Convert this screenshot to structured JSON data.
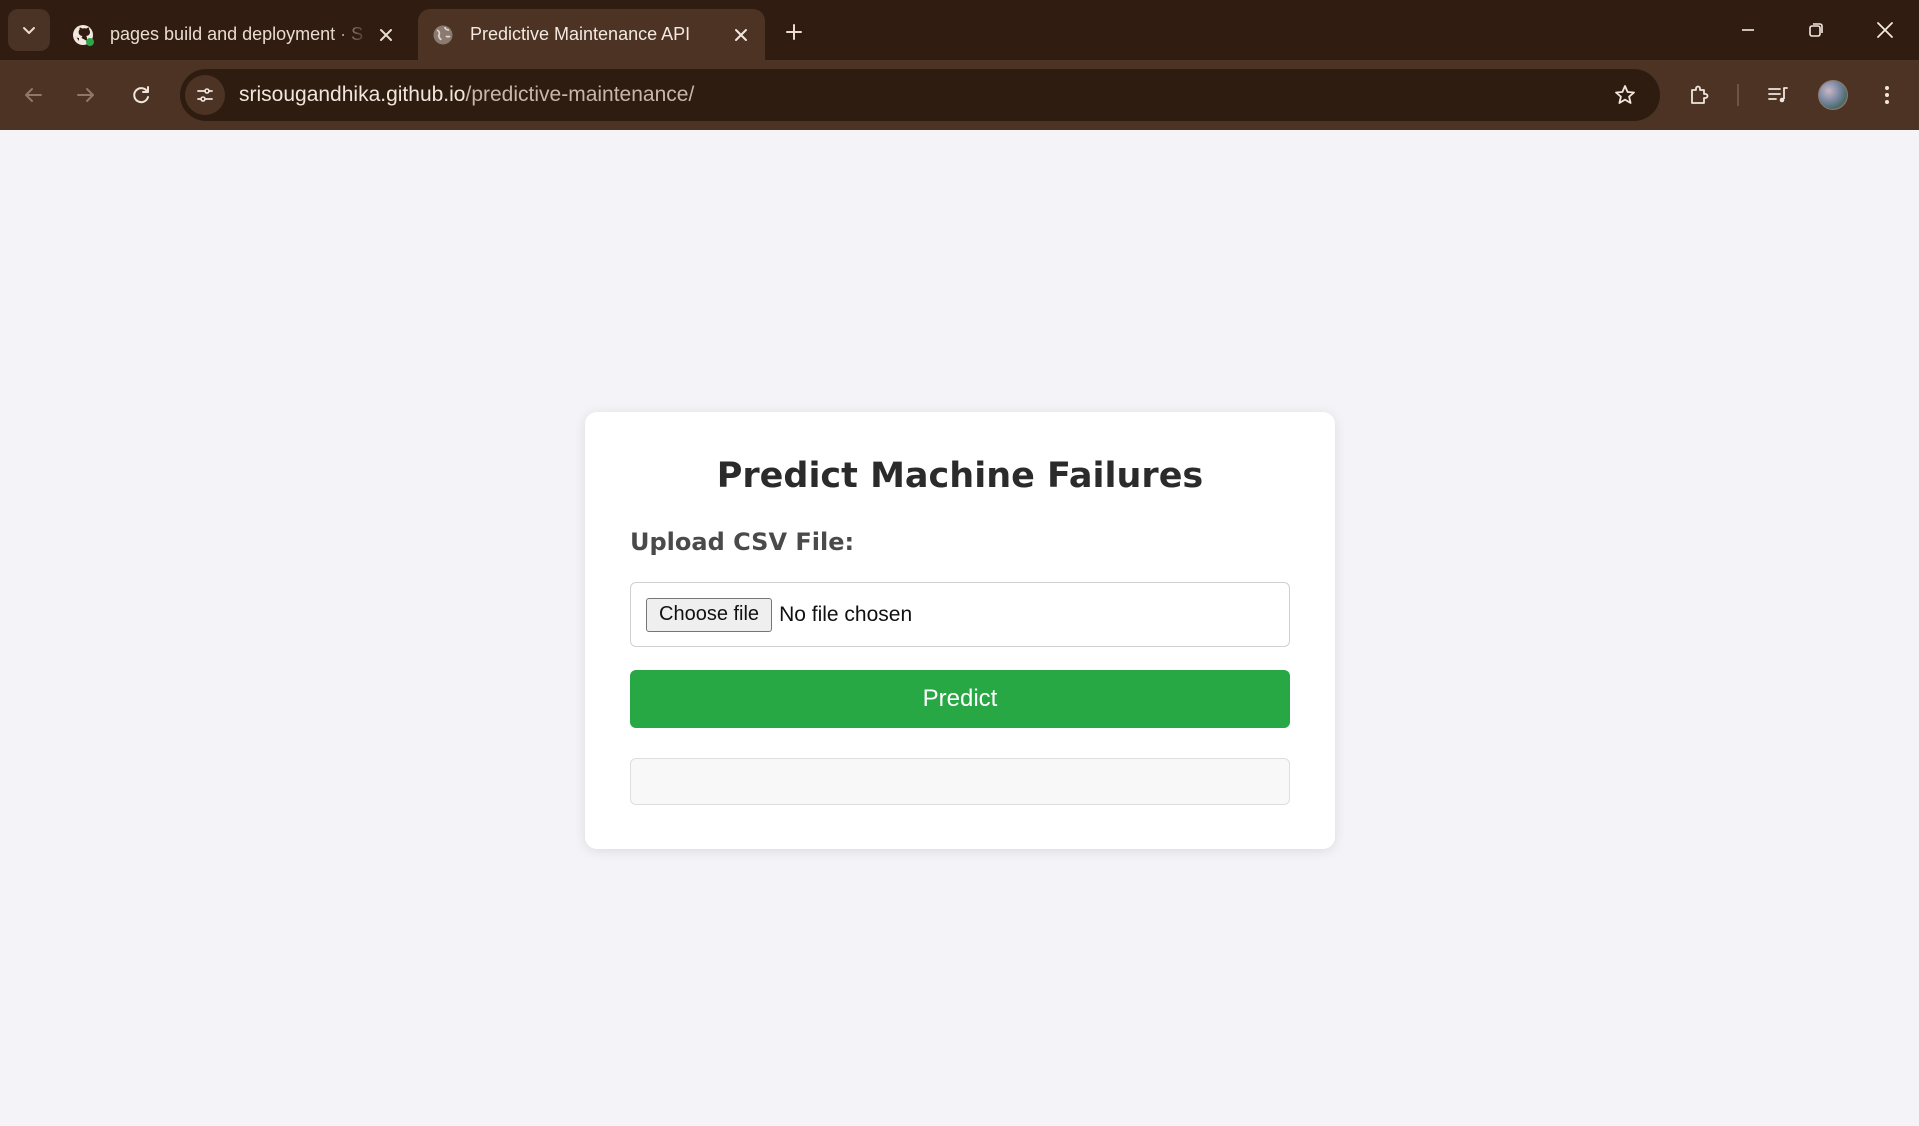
{
  "browser": {
    "tabs": [
      {
        "title": "pages build and deployment · S",
        "favicon": "github-icon",
        "active": false
      },
      {
        "title": "Predictive Maintenance API",
        "favicon": "globe-icon",
        "active": true
      }
    ],
    "address_bar": {
      "domain": "srisougandhika.github.io",
      "path": "/predictive-maintenance/"
    }
  },
  "page": {
    "heading": "Predict Machine Failures",
    "upload_label": "Upload CSV File:",
    "file_input": {
      "button_label": "Choose file",
      "status": "No file chosen"
    },
    "predict_button": "Predict",
    "result": ""
  },
  "colors": {
    "tabstrip": "#301c10",
    "toolbar": "#4c3324",
    "page_bg": "#f4f4f8",
    "predict_button": "#28a745"
  }
}
